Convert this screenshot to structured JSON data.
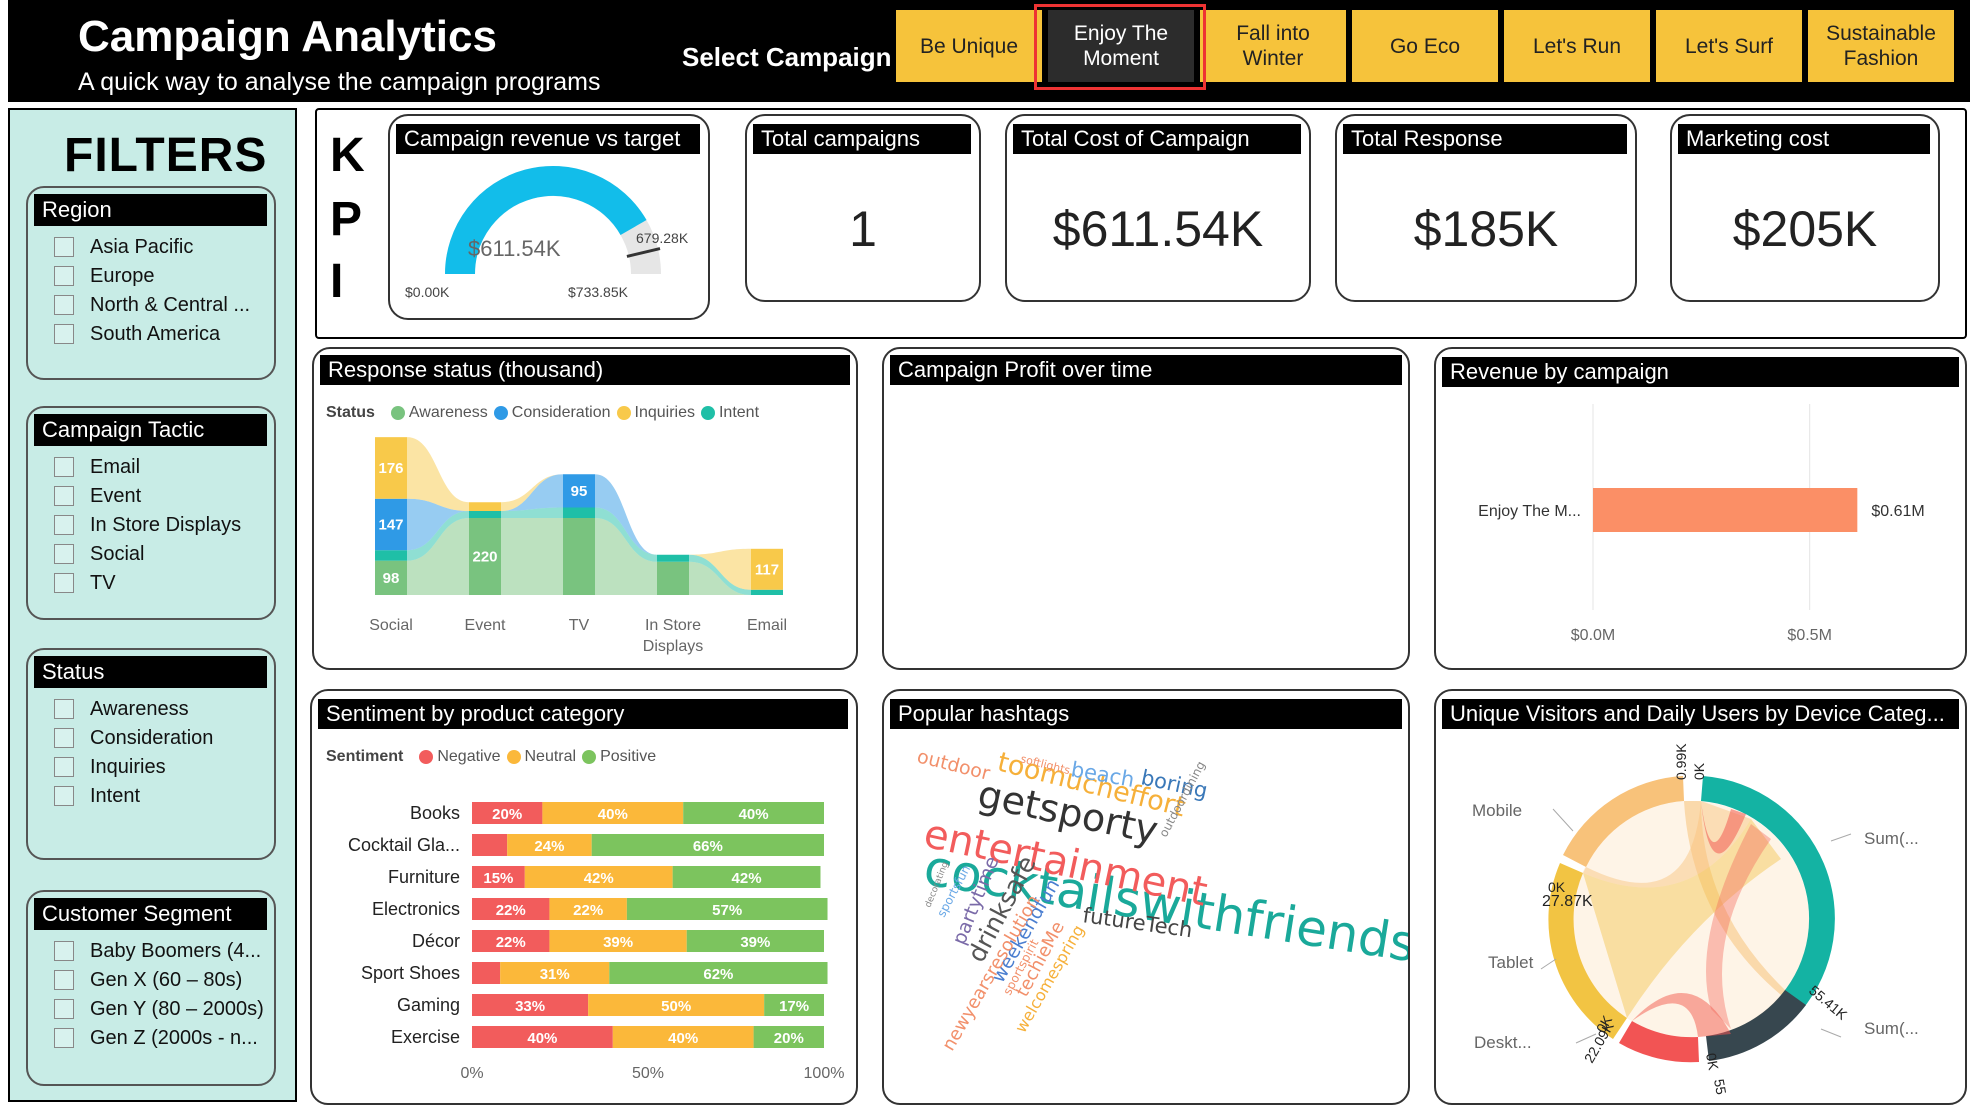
{
  "header": {
    "title": "Campaign Analytics",
    "subtitle": "A quick way to analyse the campaign programs",
    "select_label": "Select Campaign",
    "campaigns": [
      "Be Unique",
      "Enjoy The\nMoment",
      "Fall into\nWinter",
      "Go Eco",
      "Let's Run",
      "Let's Surf",
      "Sustainable\nFashion"
    ],
    "active_campaign": "Enjoy The Moment",
    "colors": {
      "button": "#f6c33b",
      "active_button": "#2c2c2c",
      "highlight": "#e33333"
    }
  },
  "filters": {
    "title": "FILTERS",
    "groups": [
      {
        "label": "Region",
        "items": [
          "Asia Pacific",
          "Europe",
          "North & Central ...",
          "South America"
        ]
      },
      {
        "label": "Campaign Tactic",
        "items": [
          "Email",
          "Event",
          "In Store Displays",
          "Social",
          "TV"
        ]
      },
      {
        "label": "Status",
        "items": [
          "Awareness",
          "Consideration",
          "Inquiries",
          "Intent"
        ]
      },
      {
        "label": "Customer Segment",
        "items": [
          "Baby Boomers (4...",
          "Gen X (60 – 80s)",
          "Gen Y (80 – 2000s)",
          "Gen Z (2000s - n..."
        ]
      }
    ]
  },
  "kpi": {
    "letters": [
      "K",
      "P",
      "I"
    ],
    "gauge": {
      "title": "Campaign revenue vs target",
      "value_label": "$611.54K",
      "target_label": "679.28K",
      "min_label": "$0.00K",
      "max_label": "$733.85K",
      "value": 611.54,
      "target": 679.28,
      "min": 0,
      "max": 733.85,
      "color": "#12bdea"
    },
    "cards": [
      {
        "title": "Total campaigns",
        "value": "1"
      },
      {
        "title": "Total Cost of Campaign",
        "value": "$611.54K"
      },
      {
        "title": "Total Response",
        "value": "$185K"
      },
      {
        "title": "Marketing cost",
        "value": "$205K"
      }
    ]
  },
  "response_status": {
    "title": "Response status (thousand)",
    "legend_title": "Status",
    "legend": [
      {
        "name": "Awareness",
        "color": "#79c37f"
      },
      {
        "name": "Consideration",
        "color": "#2f9ae6"
      },
      {
        "name": "Inquiries",
        "color": "#f8c94a"
      },
      {
        "name": "Intent",
        "color": "#1fbfa7"
      }
    ]
  },
  "profit_over_time": {
    "title": "Campaign Profit over time"
  },
  "revenue_by_campaign": {
    "title": "Revenue by campaign"
  },
  "sentiment": {
    "title": "Sentiment by product category",
    "legend_title": "Sentiment",
    "legend": [
      {
        "name": "Negative",
        "color": "#f25c5c"
      },
      {
        "name": "Neutral",
        "color": "#fbb83a"
      },
      {
        "name": "Positive",
        "color": "#7cc45e"
      }
    ]
  },
  "hashtags": {
    "title": "Popular hashtags",
    "words": [
      {
        "text": "cocktailswithfriends",
        "color": "#1aa99a"
      },
      {
        "text": "getsporty",
        "color": "#333333"
      },
      {
        "text": "entertainment",
        "color": "#f25c5c"
      },
      {
        "text": "toomucheffort",
        "color": "#f6b03a"
      },
      {
        "text": "outdoor",
        "color": "#f2906b"
      },
      {
        "text": "beach",
        "color": "#6aa8e6"
      },
      {
        "text": "boring",
        "color": "#3a78b8"
      },
      {
        "text": "futureTech",
        "color": "#444444"
      },
      {
        "text": "drinksafe",
        "color": "#555555"
      },
      {
        "text": "partytime",
        "color": "#7a6aa8"
      },
      {
        "text": "weekendfun",
        "color": "#4a7ed0"
      },
      {
        "text": "newyearsresolution",
        "color": "#f2906b"
      },
      {
        "text": "techieMe",
        "color": "#f2906b"
      },
      {
        "text": "welcomespring",
        "color": "#f6b03a"
      },
      {
        "text": "outdoordining",
        "color": "#888888"
      },
      {
        "text": "softlights",
        "color": "#f2906b"
      },
      {
        "text": "sportsfun",
        "color": "#6aa8e6"
      },
      {
        "text": "decorating",
        "color": "#888888"
      },
      {
        "text": "sportspirit",
        "color": "#f2906b"
      }
    ]
  },
  "devices": {
    "title": "Unique Visitors and Daily Users by Device Categ...",
    "labels": [
      "Mobile",
      "Tablet",
      "Deskt...",
      "Sum(...",
      "Sum(..."
    ],
    "value_labels": [
      "0.99K",
      "0K",
      "27.87K",
      "0K",
      "22.09K",
      "0K",
      "55.41K",
      "0K",
      "55"
    ],
    "colors": {
      "mobile": "#f8c27a",
      "tablet": "#f2c443",
      "desktop": "#f25454",
      "sum1": "#14b3a3",
      "sum2": "#37474f"
    }
  },
  "chart_data": [
    {
      "type": "area",
      "subtype": "ribbon",
      "categories": [
        "Social",
        "Event",
        "TV",
        "In Store\nDisplays",
        "Email"
      ],
      "series": [
        {
          "name": "Awareness",
          "values": [
            98,
            220,
            220,
            95,
            0
          ]
        },
        {
          "name": "Consideration",
          "values": [
            147,
            0,
            95,
            0,
            0
          ]
        },
        {
          "name": "Inquiries",
          "values": [
            176,
            25,
            0,
            0,
            117
          ]
        },
        {
          "name": "Intent",
          "values": [
            30,
            20,
            30,
            20,
            15
          ]
        }
      ],
      "data_labels": [
        {
          "category": "Social",
          "series": "Inquiries",
          "text": "176"
        },
        {
          "category": "Social",
          "series": "Consideration",
          "text": "147"
        },
        {
          "category": "Social",
          "series": "Awareness",
          "text": "98"
        },
        {
          "category": "Event",
          "series": "Awareness",
          "text": "220"
        },
        {
          "category": "TV",
          "series": "Consideration",
          "text": "95"
        },
        {
          "category": "Email",
          "series": "Inquiries",
          "text": "117"
        }
      ],
      "title": "Response status (thousand)",
      "legend_position": "top-left"
    },
    {
      "type": "bar",
      "orientation": "horizontal",
      "categories": [
        "Enjoy The M..."
      ],
      "values": [
        0.61
      ],
      "value_labels": [
        "$0.61M"
      ],
      "ticks": [
        "$0.0M",
        "$0.5M"
      ],
      "xlim": [
        0,
        0.75
      ],
      "color": "#fb8f66",
      "title": "Revenue by campaign"
    },
    {
      "type": "bar",
      "orientation": "horizontal",
      "stacked": "percent",
      "categories": [
        "Books",
        "Cocktail Gla...",
        "Furniture",
        "Electronics",
        "Décor",
        "Sport Shoes",
        "Gaming",
        "Exercise"
      ],
      "series": [
        {
          "name": "Negative",
          "values": [
            20,
            10,
            15,
            22,
            22,
            8,
            33,
            40
          ],
          "labels": [
            "20%",
            "",
            "15%",
            "22%",
            "22%",
            "",
            "33%",
            "40%"
          ]
        },
        {
          "name": "Neutral",
          "values": [
            40,
            24,
            42,
            22,
            39,
            31,
            50,
            40
          ],
          "labels": [
            "40%",
            "24%",
            "42%",
            "22%",
            "39%",
            "31%",
            "50%",
            "40%"
          ]
        },
        {
          "name": "Positive",
          "values": [
            40,
            66,
            42,
            57,
            39,
            62,
            17,
            20
          ],
          "labels": [
            "40%",
            "66%",
            "42%",
            "57%",
            "39%",
            "62%",
            "17%",
            "20%"
          ]
        }
      ],
      "ticks": [
        "0%",
        "50%",
        "100%"
      ],
      "xlim": [
        0,
        100
      ],
      "title": "Sentiment by product category",
      "legend_position": "top-left"
    }
  ]
}
